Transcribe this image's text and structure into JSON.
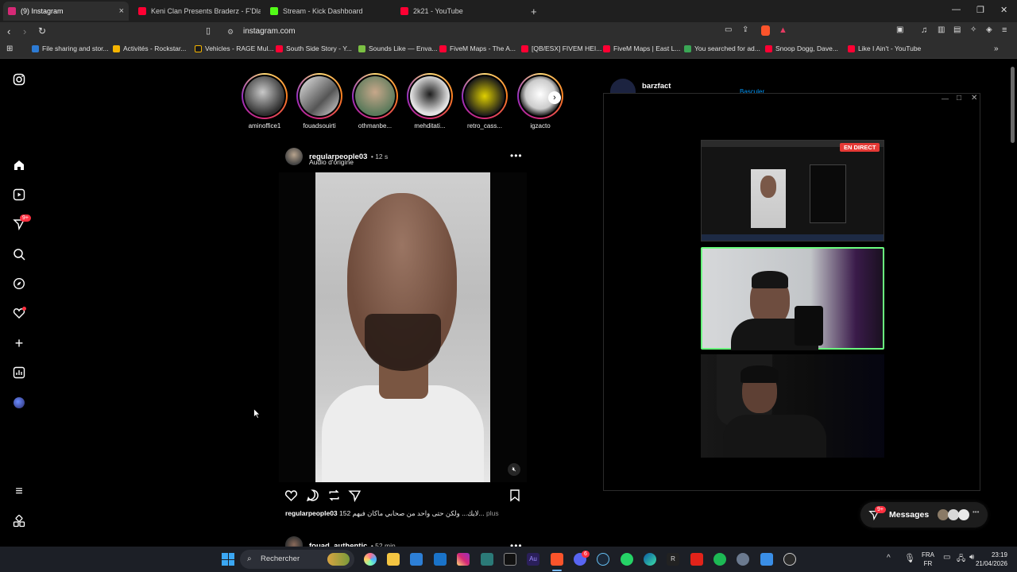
{
  "browser": {
    "tabs": [
      {
        "label": "(9) Instagram",
        "active": true,
        "color": "#d62976"
      },
      {
        "label": "Keni Clan Presents Braderz - F'Dlam",
        "active": false,
        "color": "#ff0033"
      },
      {
        "label": "Stream - Kick Dashboard",
        "active": false,
        "color": "#53fc18"
      },
      {
        "label": "2k21 - YouTube",
        "active": false,
        "color": "#ff0033"
      }
    ],
    "new_tab": "+",
    "url": "instagram.com",
    "bookmarks": [
      {
        "label": "File sharing and stor...",
        "color": "#2d7bd4"
      },
      {
        "label": "Activités - Rockstar...",
        "color": "#f5b400"
      },
      {
        "label": "Vehicles - RAGE Mul...",
        "color": "#1a1a1a"
      },
      {
        "label": "South Side Story - Y...",
        "color": "#ff0033"
      },
      {
        "label": "Sounds Like — Enva...",
        "color": "#7bc043"
      },
      {
        "label": "FiveM Maps - The A...",
        "color": "#ff0033"
      },
      {
        "label": "[QB/ESX] FIVEM HEI...",
        "color": "#ff0033"
      },
      {
        "label": "FiveM Maps | East L...",
        "color": "#ff0033"
      },
      {
        "label": "You searched for ad...",
        "color": "#3aa655"
      },
      {
        "label": "Snoop Dogg, Dave...",
        "color": "#ff0033"
      },
      {
        "label": "Like I Ain't - YouTube",
        "color": "#ff0033"
      }
    ]
  },
  "sidebar": {
    "notifications_badge": "9+"
  },
  "stories": [
    {
      "name": "aminoffice1"
    },
    {
      "name": "fouadsouirti"
    },
    {
      "name": "othmanbe..."
    },
    {
      "name": "mehditati..."
    },
    {
      "name": "retro_cass..."
    },
    {
      "name": "igzacto"
    }
  ],
  "suggested": {
    "name": "barzfact",
    "action": "Basculer"
  },
  "post": {
    "username": "regularpeople03",
    "time": "12 s",
    "audio": "Audio d'origine",
    "caption_user": "regularpeople03",
    "caption_text": "152 لايك... ولكن حتى واحد من صحابي ماكان فيهم...",
    "caption_more": "plus"
  },
  "next_post": {
    "username": "fouad_authentic",
    "time": "52 min"
  },
  "overlay": {
    "live_badge": "EN DIRECT"
  },
  "messages": {
    "label": "Messages",
    "badge": "9+"
  },
  "taskbar": {
    "search_placeholder": "Rechercher",
    "lang_top": "FRA",
    "lang_bottom": "FR",
    "time": "23:19",
    "date": "21/04/2026",
    "discord_badge": "6"
  }
}
